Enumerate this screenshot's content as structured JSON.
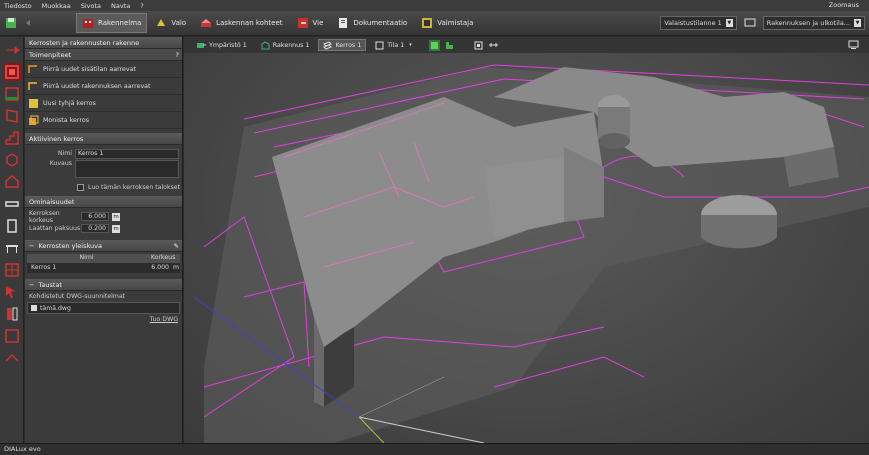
{
  "menu": {
    "items": [
      "Tiedosto",
      "Muokkaa",
      "Sivota",
      "Navta",
      "?"
    ],
    "zoom_label": "Zoomaus"
  },
  "toolbar": {
    "buttons": [
      {
        "label": "Rakennelma",
        "active": true
      },
      {
        "label": "Valo"
      },
      {
        "label": "Laskennan kohteet"
      },
      {
        "label": "Vie"
      },
      {
        "label": "Dokumentaatio"
      },
      {
        "label": "Valmistaja"
      }
    ],
    "combo_1": "Valaistustilanne 1",
    "combo_2": "Rakennuksen ja ulkotila..."
  },
  "panel": {
    "title": "Kerrosten ja rakennusten rakenne",
    "help": "?",
    "actions_header": "Toimenpiteet",
    "actions": [
      "Piirrä uudet sisätilan aarrevat",
      "Piirrä uudet rakennuksen aarrevat",
      "Uusi tyhjä kerros",
      "Monista kerros"
    ],
    "active_floor_header": "Aktiivinen kerros",
    "name_label": "Nimi",
    "name_value": "Kerros 1",
    "desc_label": "Kuvaus",
    "checkbox_label": "Luo tämän kerroksen talokset",
    "props_header": "Ominaisuudet",
    "props": [
      {
        "label": "Kerroksen korkeus",
        "value": "6.000",
        "unit": "m"
      },
      {
        "label": "Laattan paksuus",
        "value": "0.200",
        "unit": "m"
      }
    ],
    "overview_header": "Kerrosten yleiskuva",
    "overview_cols": [
      "Nimi",
      "Korkeus"
    ],
    "overview_rows": [
      {
        "name": "Kerros 1",
        "height": "6.000",
        "unit": "m"
      }
    ],
    "background_header": "Taustat",
    "dwg_label": "Kohdistetut DWG-suunnitelmat",
    "dwg_file": "tämä.dwg",
    "import_link": "Tuo DWG"
  },
  "viewport": {
    "tabs": [
      {
        "label": "Ympäristö 1"
      },
      {
        "label": "Rakennus 1"
      },
      {
        "label": "Kerros 1",
        "active": true
      },
      {
        "label": "Tila 1"
      }
    ]
  },
  "status": {
    "app_name": "DIALux evo"
  },
  "colors": {
    "accent_red": "#b22222",
    "cad_magenta": "#e040e0",
    "building_gray": "#8a8a8a"
  }
}
